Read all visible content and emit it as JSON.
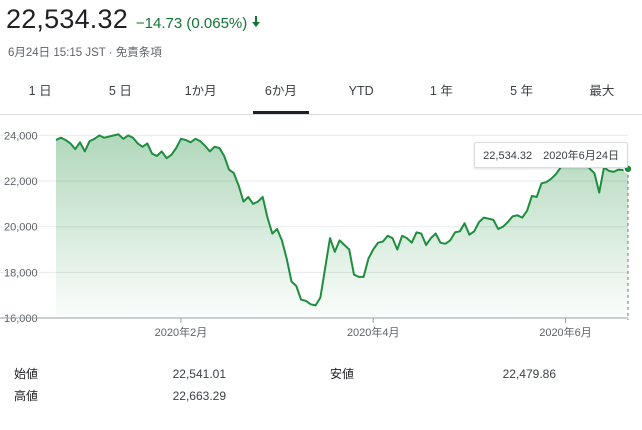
{
  "quote": {
    "price": "22,534.32",
    "change": "−14.73 (0.065%)",
    "direction": "down",
    "change_color": "#137333",
    "meta": "6月24日 15:15 JST · 免責条項"
  },
  "tabs": [
    {
      "label": "1 日",
      "active": false
    },
    {
      "label": "5 日",
      "active": false
    },
    {
      "label": "1か月",
      "active": false
    },
    {
      "label": "6か月",
      "active": true
    },
    {
      "label": "YTD",
      "active": false
    },
    {
      "label": "1 年",
      "active": false
    },
    {
      "label": "5 年",
      "active": false
    },
    {
      "label": "最大",
      "active": false
    }
  ],
  "tooltip": {
    "value": "22,534.32",
    "date": "2020年6月24日"
  },
  "chart_data": {
    "type": "area",
    "line_color": "#1e8e3e",
    "grid": true,
    "ylim": [
      16000,
      24500
    ],
    "y_ticks": [
      16000,
      18000,
      20000,
      22000,
      24000
    ],
    "y_tick_labels": [
      "16,000",
      "18,000",
      "20,000",
      "22,000",
      "24,000"
    ],
    "x_tick_labels": [
      {
        "label": "2020年2月",
        "index": 26
      },
      {
        "label": "2020年4月",
        "index": 66
      },
      {
        "label": "2020年6月",
        "index": 106
      }
    ],
    "series": [
      {
        "values": [
          23800,
          23900,
          23800,
          23650,
          23400,
          23700,
          23300,
          23750,
          23850,
          24000,
          23900,
          23950,
          24000,
          24050,
          23850,
          24000,
          23900,
          23650,
          23500,
          23650,
          23200,
          23100,
          23300,
          23000,
          23150,
          23450,
          23850,
          23800,
          23700,
          23850,
          23750,
          23550,
          23300,
          23500,
          23450,
          23100,
          22500,
          22350,
          21800,
          21100,
          21300,
          21000,
          21100,
          21300,
          20400,
          19700,
          19900,
          19400,
          18600,
          17600,
          17400,
          16800,
          16750,
          16600,
          16550,
          16900,
          18200,
          19500,
          18900,
          19400,
          19200,
          19000,
          17900,
          17800,
          17800,
          18600,
          19000,
          19300,
          19350,
          19600,
          19500,
          19000,
          19600,
          19500,
          19300,
          19750,
          19700,
          19200,
          19500,
          19700,
          19300,
          19250,
          19400,
          19750,
          19800,
          20150,
          19650,
          19800,
          20200,
          20400,
          20350,
          20300,
          19900,
          20000,
          20200,
          20450,
          20500,
          20400,
          20700,
          21350,
          21300,
          21900,
          21950,
          22100,
          22300,
          22600,
          22700,
          22950,
          23150,
          23100,
          23150,
          22550,
          22350,
          21500,
          22600,
          22450,
          22400,
          22500,
          22480,
          22534
        ]
      }
    ]
  },
  "stats": {
    "open_label": "始値",
    "open_value": "22,541.01",
    "low_label": "安値",
    "low_value": "22,479.86",
    "high_label": "高値",
    "high_value": "22,663.29"
  }
}
